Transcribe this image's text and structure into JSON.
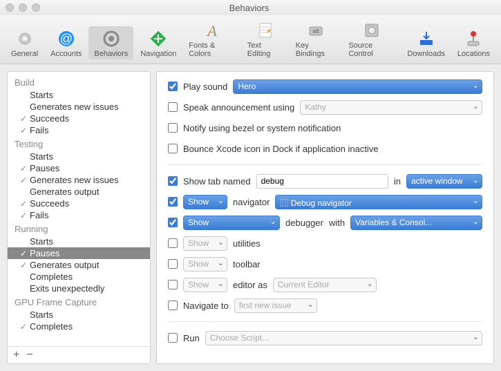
{
  "window": {
    "title": "Behaviors"
  },
  "toolbar": {
    "items": [
      {
        "label": "General"
      },
      {
        "label": "Accounts"
      },
      {
        "label": "Behaviors"
      },
      {
        "label": "Navigation"
      },
      {
        "label": "Fonts & Colors"
      },
      {
        "label": "Text Editing"
      },
      {
        "label": "Key Bindings"
      },
      {
        "label": "Source Control"
      },
      {
        "label": "Downloads"
      },
      {
        "label": "Locations"
      }
    ]
  },
  "sidebar": {
    "groups": [
      {
        "header": "Build",
        "items": [
          {
            "label": "Starts",
            "checked": false
          },
          {
            "label": "Generates new issues",
            "checked": false
          },
          {
            "label": "Succeeds",
            "checked": true
          },
          {
            "label": "Fails",
            "checked": true
          }
        ]
      },
      {
        "header": "Testing",
        "items": [
          {
            "label": "Starts",
            "checked": false
          },
          {
            "label": "Pauses",
            "checked": true
          },
          {
            "label": "Generates new issues",
            "checked": true
          },
          {
            "label": "Generates output",
            "checked": false
          },
          {
            "label": "Succeeds",
            "checked": true
          },
          {
            "label": "Fails",
            "checked": true
          }
        ]
      },
      {
        "header": "Running",
        "items": [
          {
            "label": "Starts",
            "checked": false
          },
          {
            "label": "Pauses",
            "checked": true,
            "selected": true
          },
          {
            "label": "Generates output",
            "checked": true
          },
          {
            "label": "Completes",
            "checked": false
          },
          {
            "label": "Exits unexpectedly",
            "checked": false
          }
        ]
      },
      {
        "header": "GPU Frame Capture",
        "items": [
          {
            "label": "Starts",
            "checked": false
          },
          {
            "label": "Completes",
            "checked": true
          }
        ]
      }
    ],
    "footer": {
      "add": "+",
      "remove": "−"
    }
  },
  "main": {
    "playSound": {
      "checked": true,
      "label": "Play sound",
      "value": "Hero"
    },
    "speak": {
      "checked": false,
      "label": "Speak announcement using",
      "value": "Kathy"
    },
    "notify": {
      "checked": false,
      "label": "Notify using bezel or system notification"
    },
    "bounce": {
      "checked": false,
      "label": "Bounce Xcode icon in Dock if application inactive"
    },
    "showTab": {
      "checked": true,
      "label": "Show tab named",
      "value": "debug",
      "inLabel": "in",
      "windowValue": "active window"
    },
    "navigator": {
      "checked": true,
      "action": "Show",
      "label": "navigator",
      "value": "Debug navigator"
    },
    "debugger": {
      "checked": true,
      "action": "Show",
      "label": "debugger",
      "withLabel": "with",
      "value": "Variables & Consol..."
    },
    "utilities": {
      "checked": false,
      "action": "Show",
      "label": "utilities"
    },
    "toolbarRow": {
      "checked": false,
      "action": "Show",
      "label": "toolbar"
    },
    "editor": {
      "checked": false,
      "action": "Show",
      "label": "editor as",
      "value": "Current Editor"
    },
    "navigateTo": {
      "checked": false,
      "label": "Navigate to",
      "value": "first new issue"
    },
    "run": {
      "checked": false,
      "label": "Run",
      "value": "Choose Script..."
    }
  }
}
